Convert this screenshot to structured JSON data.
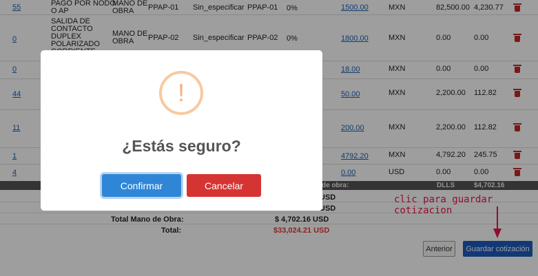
{
  "table": {
    "rows": [
      {
        "qty": "55",
        "desc": [
          "PAGO POR NODO",
          "O AP"
        ],
        "type": [
          "MANO DE",
          "OBRA"
        ],
        "ppap": "PPAP-01",
        "spec": "Sin_especificar",
        "ppap2": "PPAP-01",
        "pct": "0%",
        "price": "1500.00",
        "cur": "MXN",
        "total": "82,500.00",
        "tax": "4,230.77"
      },
      {
        "qty": "0",
        "desc": [
          "SALIDA DE",
          "CONTACTO",
          "DUPLEX",
          "POLARIZADO",
          "CORRIENTE"
        ],
        "type": [
          "MANO DE",
          "OBRA"
        ],
        "ppap": "PPAP-02",
        "spec": "Sin_especificar",
        "ppap2": "PPAP-02",
        "pct": "0%",
        "price": "1800.00",
        "cur": "MXN",
        "total": "0.00",
        "tax": "0.00"
      },
      {
        "qty": "0",
        "price": "18.00",
        "cur": "MXN",
        "total": "0.00",
        "tax": "0.00"
      },
      {
        "qty": "44",
        "price": "50.00",
        "cur": "MXN",
        "total": "2,200.00",
        "tax": "112.82"
      },
      {
        "qty": "11",
        "price": "200.00",
        "cur": "MXN",
        "total": "2,200.00",
        "tax": "112.82"
      },
      {
        "qty": "1",
        "price": "4792.20",
        "cur": "MXN",
        "total": "4,792.20",
        "tax": "245.75"
      },
      {
        "qty": "4",
        "price": "0.00",
        "cur": "USD",
        "total": "0.00",
        "tax": "0.00"
      }
    ]
  },
  "subtotal_bar": {
    "label": "de obra:",
    "currency": "DLLS",
    "amount": "$4,702.16"
  },
  "summary": {
    "usd1": "USD",
    "usd2": "USD",
    "total_mano_label": "Total Mano de Obra:",
    "total_mano_value": "$ 4,702.16 USD",
    "total_label": "Total:",
    "total_value": "$33,024.21 USD"
  },
  "buttons": {
    "prev": "Anterior",
    "save": "Guardar cotización"
  },
  "annotation": "clic para guardar cotizacion",
  "modal": {
    "icon_glyph": "!",
    "title": "¿Estás seguro?",
    "confirm": "Confirmar",
    "cancel": "Cancelar"
  },
  "colors": {
    "accent": "#1d5dbe",
    "danger": "#d63333",
    "warning": "#f8c99e",
    "annotation": "#e8174a"
  }
}
